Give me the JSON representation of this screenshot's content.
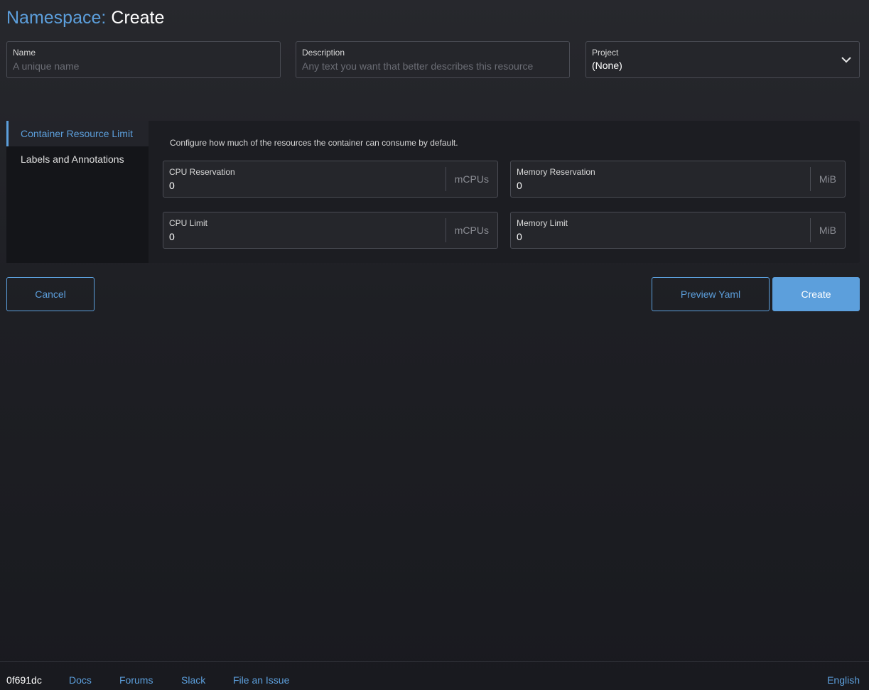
{
  "header": {
    "crumb": "Namespace:",
    "action": "Create"
  },
  "form": {
    "name": {
      "label": "Name",
      "placeholder": "A unique name",
      "value": ""
    },
    "description": {
      "label": "Description",
      "placeholder": "Any text you want that better describes this resource",
      "value": ""
    },
    "project": {
      "label": "Project",
      "value": "(None)",
      "icon": "chevron-down-icon"
    }
  },
  "tabs": [
    {
      "label": "Container Resource Limit",
      "active": true
    },
    {
      "label": "Labels and Annotations",
      "active": false
    }
  ],
  "resources": {
    "description": "Configure how much of the resources the container can consume by default.",
    "cpu_reservation": {
      "label": "CPU Reservation",
      "value": "0",
      "unit": "mCPUs"
    },
    "memory_reservation": {
      "label": "Memory Reservation",
      "value": "0",
      "unit": "MiB"
    },
    "cpu_limit": {
      "label": "CPU Limit",
      "value": "0",
      "unit": "mCPUs"
    },
    "memory_limit": {
      "label": "Memory Limit",
      "value": "0",
      "unit": "MiB"
    }
  },
  "actions": {
    "cancel": "Cancel",
    "preview": "Preview Yaml",
    "create": "Create"
  },
  "footer": {
    "version": "0f691dc",
    "links": [
      "Docs",
      "Forums",
      "Slack",
      "File an Issue"
    ],
    "language": "English"
  },
  "colors": {
    "accent": "#5c9fdc",
    "background": "#1e1f24"
  }
}
